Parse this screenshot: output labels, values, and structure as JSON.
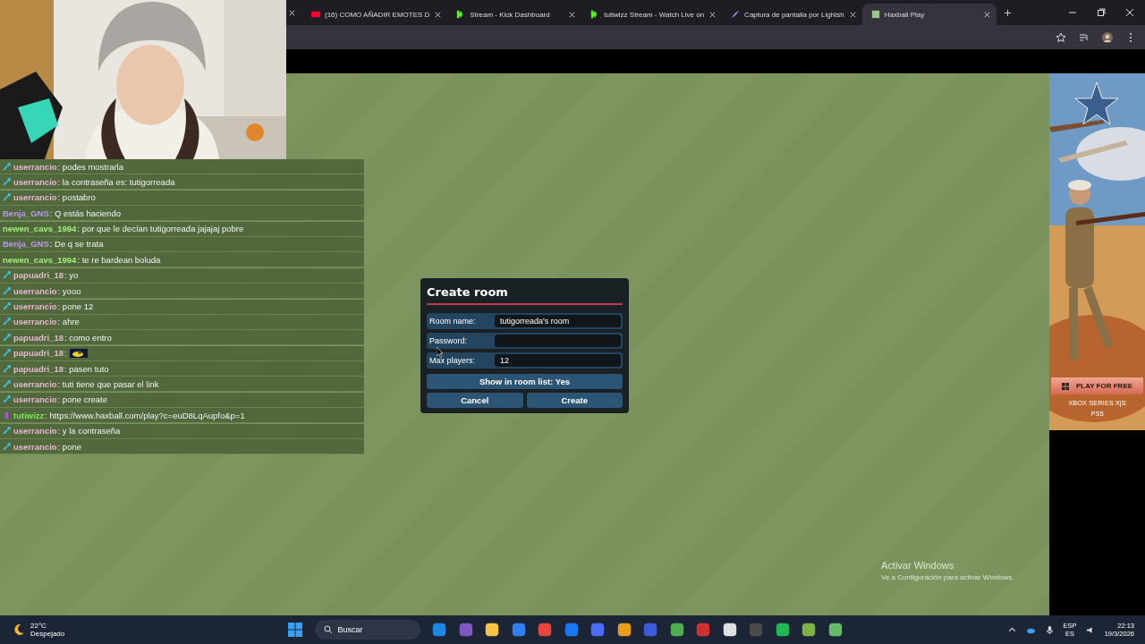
{
  "browser": {
    "tabs": [
      {
        "label": "(16) COMO AÑADIR EMOTES D",
        "kind": "youtube",
        "selected": false
      },
      {
        "label": "Stream - Kick Dashboard",
        "kind": "kick",
        "selected": false
      },
      {
        "label": "tutiwizz Stream - Watch Live on",
        "kind": "kick",
        "selected": false
      },
      {
        "label": "Captura de pantalla por Lightsh",
        "kind": "feather",
        "selected": false
      },
      {
        "label": "Haxball Play",
        "kind": "haxball",
        "selected": true
      }
    ]
  },
  "chat": [
    {
      "user": "userrancio",
      "color": "#e6b8cf",
      "mod": true,
      "broadcaster": false,
      "kind": "text",
      "text": ": podes mostrarla"
    },
    {
      "user": "userrancio",
      "color": "#e6b8cf",
      "mod": true,
      "broadcaster": false,
      "kind": "text",
      "text": ": la contraseña es: tutigorreada"
    },
    {
      "user": "userrancio",
      "color": "#e6b8cf",
      "mod": true,
      "broadcaster": false,
      "kind": "text",
      "text": ": postabro"
    },
    {
      "user": "Benja_GNS",
      "color": "#b99be6",
      "mod": false,
      "broadcaster": false,
      "kind": "text",
      "text": ": Q estás haciendo"
    },
    {
      "user": "newen_cavs_1994",
      "color": "#9ff27c",
      "mod": false,
      "broadcaster": false,
      "kind": "text",
      "text": ": por que le decían tutigorreada jajajaj pobre"
    },
    {
      "user": "Benja_GNS",
      "color": "#b99be6",
      "mod": false,
      "broadcaster": false,
      "kind": "text",
      "text": ": De q se trata"
    },
    {
      "user": "newen_cavs_1994",
      "color": "#9ff27c",
      "mod": false,
      "broadcaster": false,
      "kind": "text",
      "text": ": te re bardean boluda"
    },
    {
      "user": "papuadri_18",
      "color": "#e6b8cf",
      "mod": true,
      "broadcaster": false,
      "kind": "text",
      "text": ": yo"
    },
    {
      "user": "userrancio",
      "color": "#e6b8cf",
      "mod": true,
      "broadcaster": false,
      "kind": "text",
      "text": ": yooo"
    },
    {
      "user": "userrancio",
      "color": "#e6b8cf",
      "mod": true,
      "broadcaster": false,
      "kind": "text",
      "text": ": pone 12"
    },
    {
      "user": "userrancio",
      "color": "#e6b8cf",
      "mod": true,
      "broadcaster": false,
      "kind": "text",
      "text": ": ahre"
    },
    {
      "user": "papuadri_18",
      "color": "#e6b8cf",
      "mod": true,
      "broadcaster": false,
      "kind": "text",
      "text": ": como entro"
    },
    {
      "user": "papuadri_18",
      "color": "#e6b8cf",
      "mod": true,
      "broadcaster": false,
      "kind": "emote",
      "text": ":"
    },
    {
      "user": "papuadri_18",
      "color": "#e6b8cf",
      "mod": true,
      "broadcaster": false,
      "kind": "text",
      "text": ": pasen tuto"
    },
    {
      "user": "userrancio",
      "color": "#e6b8cf",
      "mod": true,
      "broadcaster": false,
      "kind": "text",
      "text": ": tuti tiene que pasar el link"
    },
    {
      "user": "userrancio",
      "color": "#e6b8cf",
      "mod": true,
      "broadcaster": false,
      "kind": "text",
      "text": ": pone create"
    },
    {
      "user": "tutiwizz",
      "color": "#86e25c",
      "mod": false,
      "broadcaster": true,
      "kind": "text",
      "text": ": https://www.haxball.com/play?c=euD8LqAupfo&p=1"
    },
    {
      "user": "userrancio",
      "color": "#e6b8cf",
      "mod": true,
      "broadcaster": false,
      "kind": "text",
      "text": ": y la contraseña"
    },
    {
      "user": "userrancio",
      "color": "#e6b8cf",
      "mod": true,
      "broadcaster": false,
      "kind": "text",
      "text": ": pone"
    }
  ],
  "dialog": {
    "title": "Create room",
    "fields": [
      {
        "label": "Room name:",
        "value": "tutigorreada's room"
      },
      {
        "label": "Password:"
      },
      {
        "label": "Max players:",
        "value": "12"
      }
    ],
    "toggle": "Show in room list: Yes",
    "buttons": [
      "Cancel",
      "Create"
    ]
  },
  "ad": {
    "button": "PLAY FOR FREE",
    "platforms": [
      "XBOX SERIES X|S",
      "PS5"
    ]
  },
  "watermark": {
    "title": "Activar Windows",
    "text": "Ve a Configuración para activar Windows."
  },
  "taskbar": {
    "weather": {
      "temp": "22°C",
      "text": "Despejado"
    },
    "search": "Buscar",
    "lang": [
      "ESP",
      "ES"
    ],
    "time": "22:13",
    "date": "19/3/2026"
  }
}
